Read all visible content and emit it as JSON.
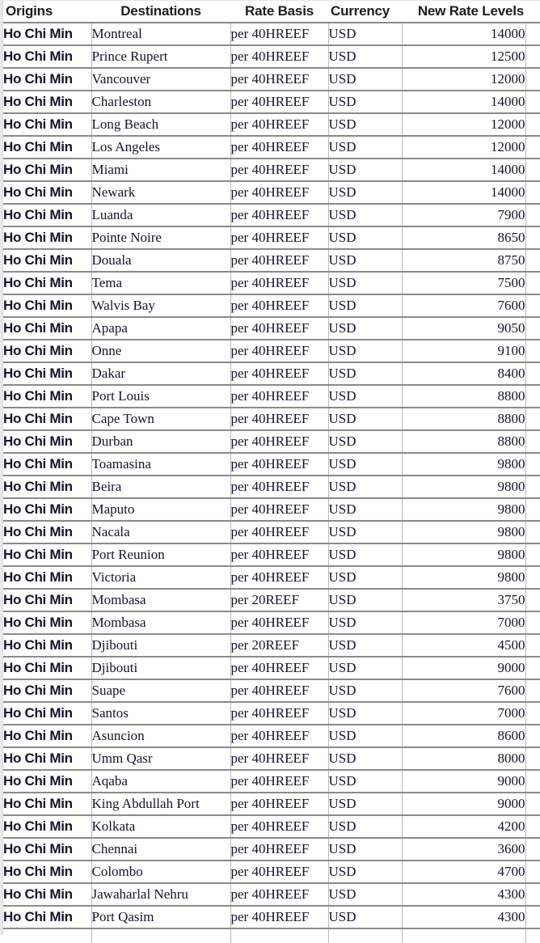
{
  "table": {
    "columns": [
      {
        "key": "origin",
        "label": "Origins"
      },
      {
        "key": "dest",
        "label": "Destinations"
      },
      {
        "key": "basis",
        "label": "Rate Basis"
      },
      {
        "key": "currency",
        "label": "Currency"
      },
      {
        "key": "rate",
        "label": "New Rate Levels"
      }
    ],
    "selection": {
      "row_index": 16,
      "marker_color": "#1a6b42"
    },
    "rows": [
      {
        "origin": "Ho Chi Min",
        "dest": "Montreal",
        "basis": "per 40HREEF",
        "currency": "USD",
        "rate": "14000"
      },
      {
        "origin": "Ho Chi Min",
        "dest": "Prince Rupert",
        "basis": "per 40HREEF",
        "currency": "USD",
        "rate": "12500"
      },
      {
        "origin": "Ho Chi Min",
        "dest": "Vancouver",
        "basis": "per 40HREEF",
        "currency": "USD",
        "rate": "12000"
      },
      {
        "origin": "Ho Chi Min",
        "dest": "Charleston",
        "basis": "per 40HREEF",
        "currency": "USD",
        "rate": "14000"
      },
      {
        "origin": "Ho Chi Min",
        "dest": "Long Beach",
        "basis": "per 40HREEF",
        "currency": "USD",
        "rate": "12000"
      },
      {
        "origin": "Ho Chi Min",
        "dest": "Los Angeles",
        "basis": "per 40HREEF",
        "currency": "USD",
        "rate": "12000"
      },
      {
        "origin": "Ho Chi Min",
        "dest": "Miami",
        "basis": "per 40HREEF",
        "currency": "USD",
        "rate": "14000"
      },
      {
        "origin": "Ho Chi Min",
        "dest": "Newark",
        "basis": "per 40HREEF",
        "currency": "USD",
        "rate": "14000"
      },
      {
        "origin": "Ho Chi Min",
        "dest": "Luanda",
        "basis": "per 40HREEF",
        "currency": "USD",
        "rate": "7900"
      },
      {
        "origin": "Ho Chi Min",
        "dest": "Pointe Noire",
        "basis": "per 40HREEF",
        "currency": "USD",
        "rate": "8650"
      },
      {
        "origin": "Ho Chi Min",
        "dest": "Douala",
        "basis": "per 40HREEF",
        "currency": "USD",
        "rate": "8750"
      },
      {
        "origin": "Ho Chi Min",
        "dest": "Tema",
        "basis": "per 40HREEF",
        "currency": "USD",
        "rate": "7500"
      },
      {
        "origin": "Ho Chi Min",
        "dest": "Walvis Bay",
        "basis": "per 40HREEF",
        "currency": "USD",
        "rate": "7600"
      },
      {
        "origin": "Ho Chi Min",
        "dest": "Apapa",
        "basis": "per 40HREEF",
        "currency": "USD",
        "rate": "9050"
      },
      {
        "origin": "Ho Chi Min",
        "dest": "Onne",
        "basis": "per 40HREEF",
        "currency": "USD",
        "rate": "9100"
      },
      {
        "origin": "Ho Chi Min",
        "dest": "Dakar",
        "basis": "per 40HREEF",
        "currency": "USD",
        "rate": "8400"
      },
      {
        "origin": "Ho Chi Min",
        "dest": "Port Louis",
        "basis": "per 40HREEF",
        "currency": "USD",
        "rate": "8800"
      },
      {
        "origin": "Ho Chi Min",
        "dest": "Cape Town",
        "basis": "per 40HREEF",
        "currency": "USD",
        "rate": "8800"
      },
      {
        "origin": "Ho Chi Min",
        "dest": "Durban",
        "basis": "per 40HREEF",
        "currency": "USD",
        "rate": "8800"
      },
      {
        "origin": "Ho Chi Min",
        "dest": "Toamasina",
        "basis": "per 40HREEF",
        "currency": "USD",
        "rate": "9800"
      },
      {
        "origin": "Ho Chi Min",
        "dest": "Beira",
        "basis": "per 40HREEF",
        "currency": "USD",
        "rate": "9800"
      },
      {
        "origin": "Ho Chi Min",
        "dest": "Maputo",
        "basis": "per 40HREEF",
        "currency": "USD",
        "rate": "9800"
      },
      {
        "origin": "Ho Chi Min",
        "dest": "Nacala",
        "basis": "per 40HREEF",
        "currency": "USD",
        "rate": "9800"
      },
      {
        "origin": "Ho Chi Min",
        "dest": "Port Reunion",
        "basis": "per 40HREEF",
        "currency": "USD",
        "rate": "9800"
      },
      {
        "origin": "Ho Chi Min",
        "dest": "Victoria",
        "basis": "per 40HREEF",
        "currency": "USD",
        "rate": "9800"
      },
      {
        "origin": "Ho Chi Min",
        "dest": "Mombasa",
        "basis": "per 20REEF",
        "currency": "USD",
        "rate": "3750"
      },
      {
        "origin": "Ho Chi Min",
        "dest": "Mombasa",
        "basis": "per 40HREEF",
        "currency": "USD",
        "rate": "7000"
      },
      {
        "origin": "Ho Chi Min",
        "dest": "Djibouti",
        "basis": "per 20REEF",
        "currency": "USD",
        "rate": "4500"
      },
      {
        "origin": "Ho Chi Min",
        "dest": "Djibouti",
        "basis": "per 40HREEF",
        "currency": "USD",
        "rate": "9000"
      },
      {
        "origin": "Ho Chi Min",
        "dest": "Suape",
        "basis": "per 40HREEF",
        "currency": "USD",
        "rate": "7600"
      },
      {
        "origin": "Ho Chi Min",
        "dest": "Santos",
        "basis": "per 40HREEF",
        "currency": "USD",
        "rate": "7000"
      },
      {
        "origin": "Ho Chi Min",
        "dest": "Asuncion",
        "basis": "per 40HREEF",
        "currency": "USD",
        "rate": "8600"
      },
      {
        "origin": "Ho Chi Min",
        "dest": "Umm Qasr",
        "basis": "per 40HREEF",
        "currency": "USD",
        "rate": "8000"
      },
      {
        "origin": "Ho Chi Min",
        "dest": "Aqaba",
        "basis": "per 40HREEF",
        "currency": "USD",
        "rate": "9000"
      },
      {
        "origin": "Ho Chi Min",
        "dest": "King Abdullah Port",
        "basis": "per 40HREEF",
        "currency": "USD",
        "rate": "9000"
      },
      {
        "origin": "Ho Chi Min",
        "dest": "Kolkata",
        "basis": "per 40HREEF",
        "currency": "USD",
        "rate": "4200"
      },
      {
        "origin": "Ho Chi Min",
        "dest": "Chennai",
        "basis": "per 40HREEF",
        "currency": "USD",
        "rate": "3600"
      },
      {
        "origin": "Ho Chi Min",
        "dest": "Colombo",
        "basis": "per 40HREEF",
        "currency": "USD",
        "rate": "4700"
      },
      {
        "origin": "Ho Chi Min",
        "dest": "Jawaharlal Nehru",
        "basis": "per 40HREEF",
        "currency": "USD",
        "rate": "4300"
      },
      {
        "origin": "Ho Chi Min",
        "dest": "Port Qasim",
        "basis": "per 40HREEF",
        "currency": "USD",
        "rate": "4300"
      }
    ]
  }
}
